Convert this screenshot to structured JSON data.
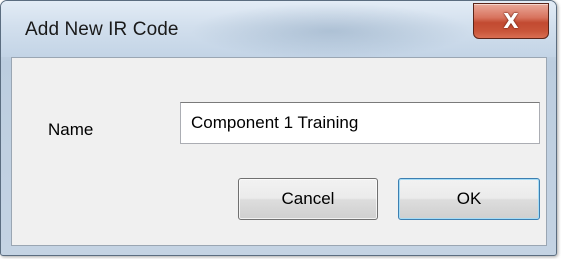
{
  "dialog": {
    "title": "Add New IR Code",
    "close_glyph": "X",
    "close_icon": "close-icon"
  },
  "form": {
    "name_label": "Name",
    "name_value": "Component 1 Training"
  },
  "buttons": {
    "cancel_label": "Cancel",
    "ok_label": "OK"
  },
  "colors": {
    "close_button": "#c24a31",
    "default_button_border": "#3c7fb1",
    "client_background": "#f0f0f0"
  }
}
